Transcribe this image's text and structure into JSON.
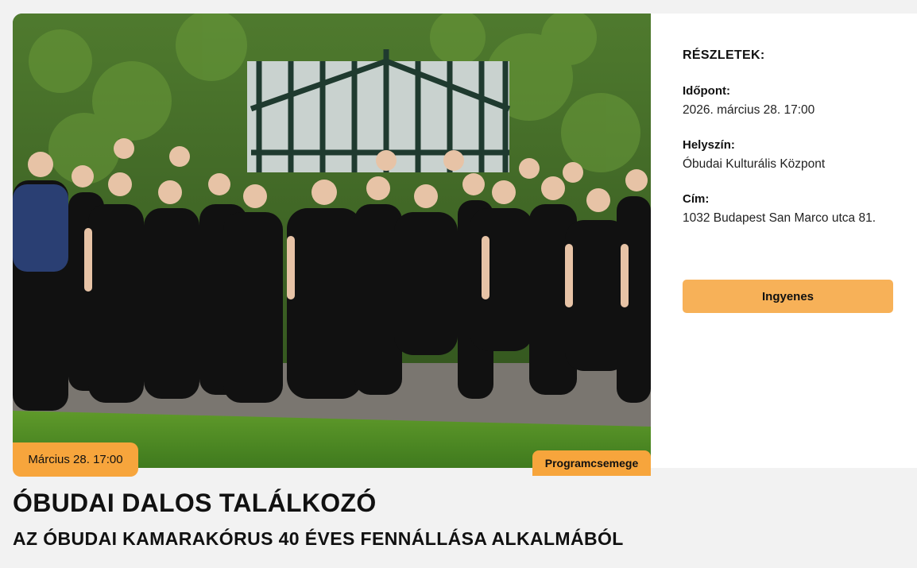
{
  "event": {
    "date_badge": "Március 28. 17:00",
    "category_tag": "Programcsemege",
    "title": "ÓBUDAI DALOS TALÁLKOZÓ",
    "subtitle": "AZ ÓBUDAI KAMARAKÓRUS 40 ÉVES FENNÁLLÁSA ALKALMÁBÓL",
    "image_alt": "choir-group-photo"
  },
  "details": {
    "heading": "RÉSZLETEK:",
    "time_label": "Időpont:",
    "time_value": "2026. március 28. 17:00",
    "venue_label": "Helyszín:",
    "venue_value": "Óbudai Kulturális Központ",
    "address_label": "Cím:",
    "address_value": "1032 Budapest San Marco utca 81.",
    "price_button": "Ingyenes"
  },
  "colors": {
    "accent": "#f7a53c",
    "button": "#f7b158",
    "page_bg": "#f2f2f2",
    "panel_bg": "#ffffff"
  }
}
